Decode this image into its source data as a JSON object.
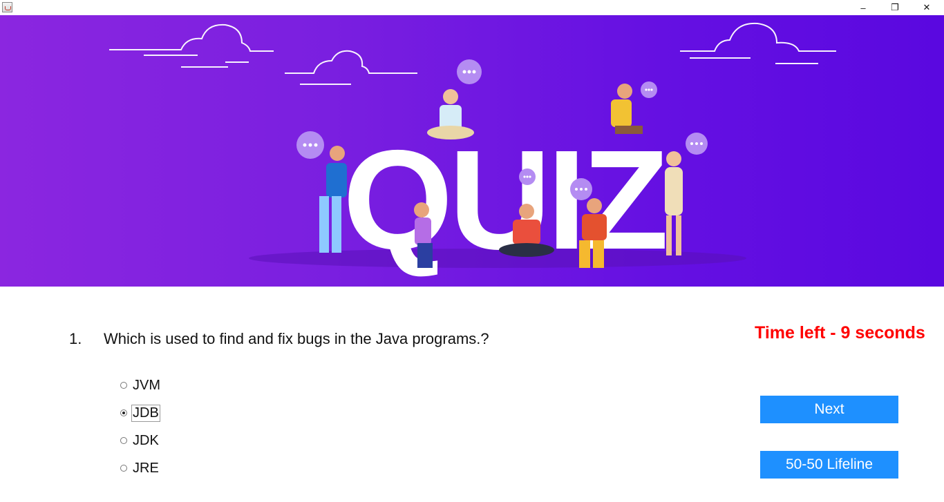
{
  "window": {
    "min_glyph": "–",
    "max_glyph": "❐",
    "close_glyph": "✕"
  },
  "question": {
    "number": "1.",
    "text": "Which is used to find and fix bugs in the Java programs.?"
  },
  "timer": {
    "text": "Time left - 9 seconds",
    "color": "#ff0000"
  },
  "options": [
    {
      "label": "JVM",
      "selected": false
    },
    {
      "label": "JDB",
      "selected": true
    },
    {
      "label": "JDK",
      "selected": false
    },
    {
      "label": "JRE",
      "selected": false
    }
  ],
  "buttons": {
    "next": "Next",
    "lifeline": "50-50 Lifeline",
    "color": "#1e90ff"
  },
  "banner": {
    "word": "QUIZ",
    "accent": "#7a1fe0"
  }
}
